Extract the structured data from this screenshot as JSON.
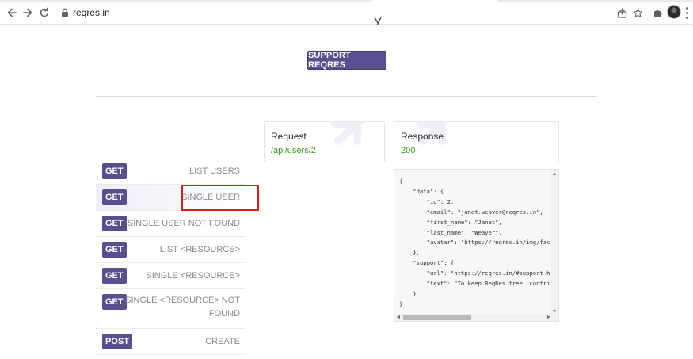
{
  "browser": {
    "url": "reqres.in",
    "icons": [
      "back-arrow-icon",
      "forward-arrow-icon",
      "reload-icon",
      "lock-icon",
      "share-icon",
      "star-icon",
      "extensions-puzzle-icon",
      "profile-avatar",
      "menu-dots-icon"
    ]
  },
  "page": {
    "support_button": "SUPPORT REQRES"
  },
  "endpoints": [
    {
      "method": "GET",
      "label_lines": [
        "LIST USERS"
      ]
    },
    {
      "method": "GET",
      "label_lines": [
        "SINGLE USER"
      ],
      "active": true
    },
    {
      "method": "GET",
      "label_lines": [
        "SINGLE USER NOT FOUND"
      ]
    },
    {
      "method": "GET",
      "label_lines": [
        "LIST <RESOURCE>"
      ]
    },
    {
      "method": "GET",
      "label_lines": [
        "SINGLE <RESOURCE>"
      ]
    },
    {
      "method": "GET",
      "label_lines": [
        "SINGLE <RESOURCE> NOT",
        "FOUND"
      ]
    },
    {
      "method": "POST",
      "label_lines": [
        "CREATE"
      ]
    }
  ],
  "request": {
    "title": "Request",
    "path": "/api/users/2"
  },
  "response": {
    "title": "Response",
    "status": "200",
    "body_lines": [
      "{",
      "    \"data\": {",
      "        \"id\": 2,",
      "        \"email\": \"janet.weaver@reqres.in\",",
      "        \"first_name\": \"Janet\",",
      "        \"last_name\": \"Weaver\",",
      "        \"avatar\": \"https://reqres.in/img/fac",
      "    },",
      "    \"support\": {",
      "        \"url\": \"https://reqres.in/#support-h",
      "        \"text\": \"To keep ReqRes free, contri",
      "    }",
      "}"
    ]
  },
  "colors": {
    "accent": "#5a4e8e",
    "status_green": "#3a9a1e",
    "highlight_red": "#d91e1e"
  }
}
